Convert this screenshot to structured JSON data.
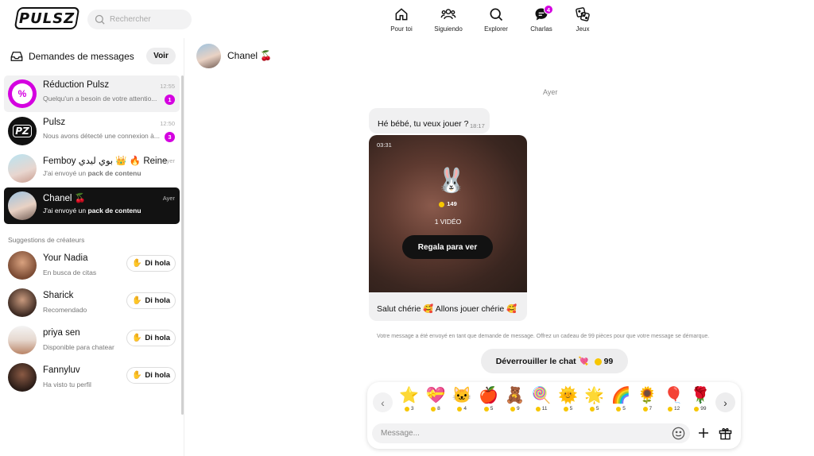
{
  "logo": "PULSZ",
  "search": {
    "placeholder": "Rechercher"
  },
  "nav": [
    {
      "label": "Pour toi",
      "icon": "home-icon"
    },
    {
      "label": "Siguiendo",
      "icon": "people-icon"
    },
    {
      "label": "Explorer",
      "icon": "search-icon"
    },
    {
      "label": "Charlas",
      "icon": "chat-icon",
      "badge": "4"
    },
    {
      "label": "Jeux",
      "icon": "dice-icon"
    }
  ],
  "sidebar": {
    "requests_title": "Demandes de messages",
    "voir_label": "Voir",
    "conversations": [
      {
        "name": "Réduction Pulsz",
        "preview": "Quelqu'un a besoin de votre attentio...",
        "time": "12:55",
        "count": "1"
      },
      {
        "name": "Pulsz",
        "preview": "Nous avons détecté une connexion à...",
        "time": "12:50",
        "count": "3"
      },
      {
        "name": "Femboy بوي ليدي 👑 🔥 Reine",
        "preview_pre": "J'ai envoyé un ",
        "preview_bold": "pack de contenu",
        "time": "Ayer"
      },
      {
        "name": "Chanel 🍒",
        "preview_pre": "J'ai envoyé un ",
        "preview_bold": "pack de contenu",
        "time": "Ayer"
      }
    ],
    "suggestions_title": "Suggestions de créateurs",
    "suggestions": [
      {
        "name": "Your Nadia",
        "sub": "En busca de citas",
        "button": "Di hola"
      },
      {
        "name": "Sharick",
        "sub": "Recomendado",
        "button": "Di hola"
      },
      {
        "name": "priya sen",
        "sub": "Disponible para chatear",
        "button": "Di hola"
      },
      {
        "name": "Fannyluv",
        "sub": "Ha visto tu perfil",
        "button": "Di hola"
      }
    ]
  },
  "chat": {
    "contact_name": "Chanel 🍒",
    "day_label": "Ayer",
    "message_text": "Hé bébé, tu veux jouer ?",
    "message_time": "18:17",
    "media": {
      "duration": "03:31",
      "price": "149",
      "count_label": "1 VIDÉO",
      "button": "Regala para ver",
      "caption": "Salut chérie 🥰 Allons jouer chérie 🥰"
    },
    "notice": "Votre message a été envoyé en tant que demande de message. Offrez un cadeau de 99 pièces pour que votre message se démarque.",
    "unlock_label": "Déverrouiller le chat 💘",
    "unlock_price": "99"
  },
  "gifts": [
    {
      "icon": "⭐",
      "name": "star-gift-icon",
      "price": "3"
    },
    {
      "icon": "💝",
      "name": "heart-gift-icon",
      "price": "8"
    },
    {
      "icon": "🐱",
      "name": "cat-gift-icon",
      "price": "4"
    },
    {
      "icon": "🍎",
      "name": "apple-gift-icon",
      "price": "5"
    },
    {
      "icon": "🧸",
      "name": "teddy-gift-icon",
      "price": "9"
    },
    {
      "icon": "🍭",
      "name": "lollipop-gift-icon",
      "price": "11"
    },
    {
      "icon": "🌞",
      "name": "sun-gift-icon",
      "price": "5"
    },
    {
      "icon": "🌟",
      "name": "purple-star-gift-icon",
      "price": "5"
    },
    {
      "icon": "🌈",
      "name": "rainbow-gift-icon",
      "price": "5"
    },
    {
      "icon": "🌻",
      "name": "sunflower-gift-icon",
      "price": "7"
    },
    {
      "icon": "🎈",
      "name": "balloon-gift-icon",
      "price": "12"
    },
    {
      "icon": "🌹",
      "name": "rose-gift-icon",
      "price": "99"
    }
  ],
  "composer": {
    "placeholder": "Message..."
  },
  "colors": {
    "accent": "#d400e0",
    "dark": "#121212",
    "coin": "#f7c600"
  }
}
